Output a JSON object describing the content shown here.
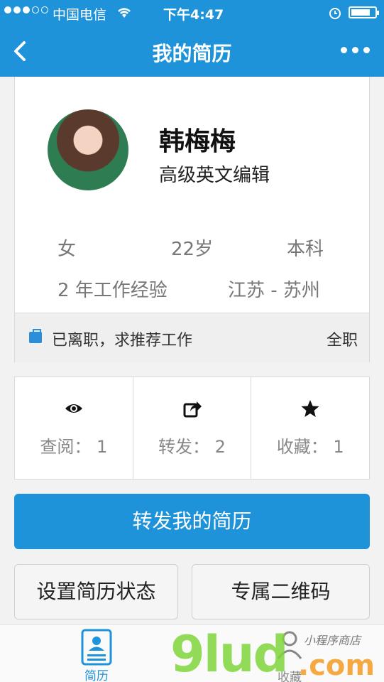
{
  "statusbar": {
    "carrier": "中国电信",
    "time": "下午4:47",
    "battery_level": 0.8
  },
  "nav": {
    "title": "我的简历"
  },
  "profile": {
    "name": "韩梅梅",
    "job_title": "高级英文编辑",
    "gender": "女",
    "age": "22岁",
    "education": "本科",
    "experience": "2 年工作经验",
    "location": "江苏 - 苏州",
    "job_status": "已离职，求推荐工作",
    "job_type": "全职"
  },
  "stats": [
    {
      "icon": "eye-icon",
      "label": "查阅：  1"
    },
    {
      "icon": "share-icon",
      "label": "转发：  2"
    },
    {
      "icon": "star-icon",
      "label": "收藏：  1"
    }
  ],
  "actions": {
    "forward": "转发我的简历",
    "set_status": "设置简历状态",
    "qr_code": "专属二维码"
  },
  "tabbar": {
    "resume": "简历",
    "favorites": "收藏"
  },
  "watermark": {
    "text": "9lud",
    "com": ".com",
    "tagline": "小程序商店"
  },
  "colors": {
    "brand": "#1f93da"
  }
}
